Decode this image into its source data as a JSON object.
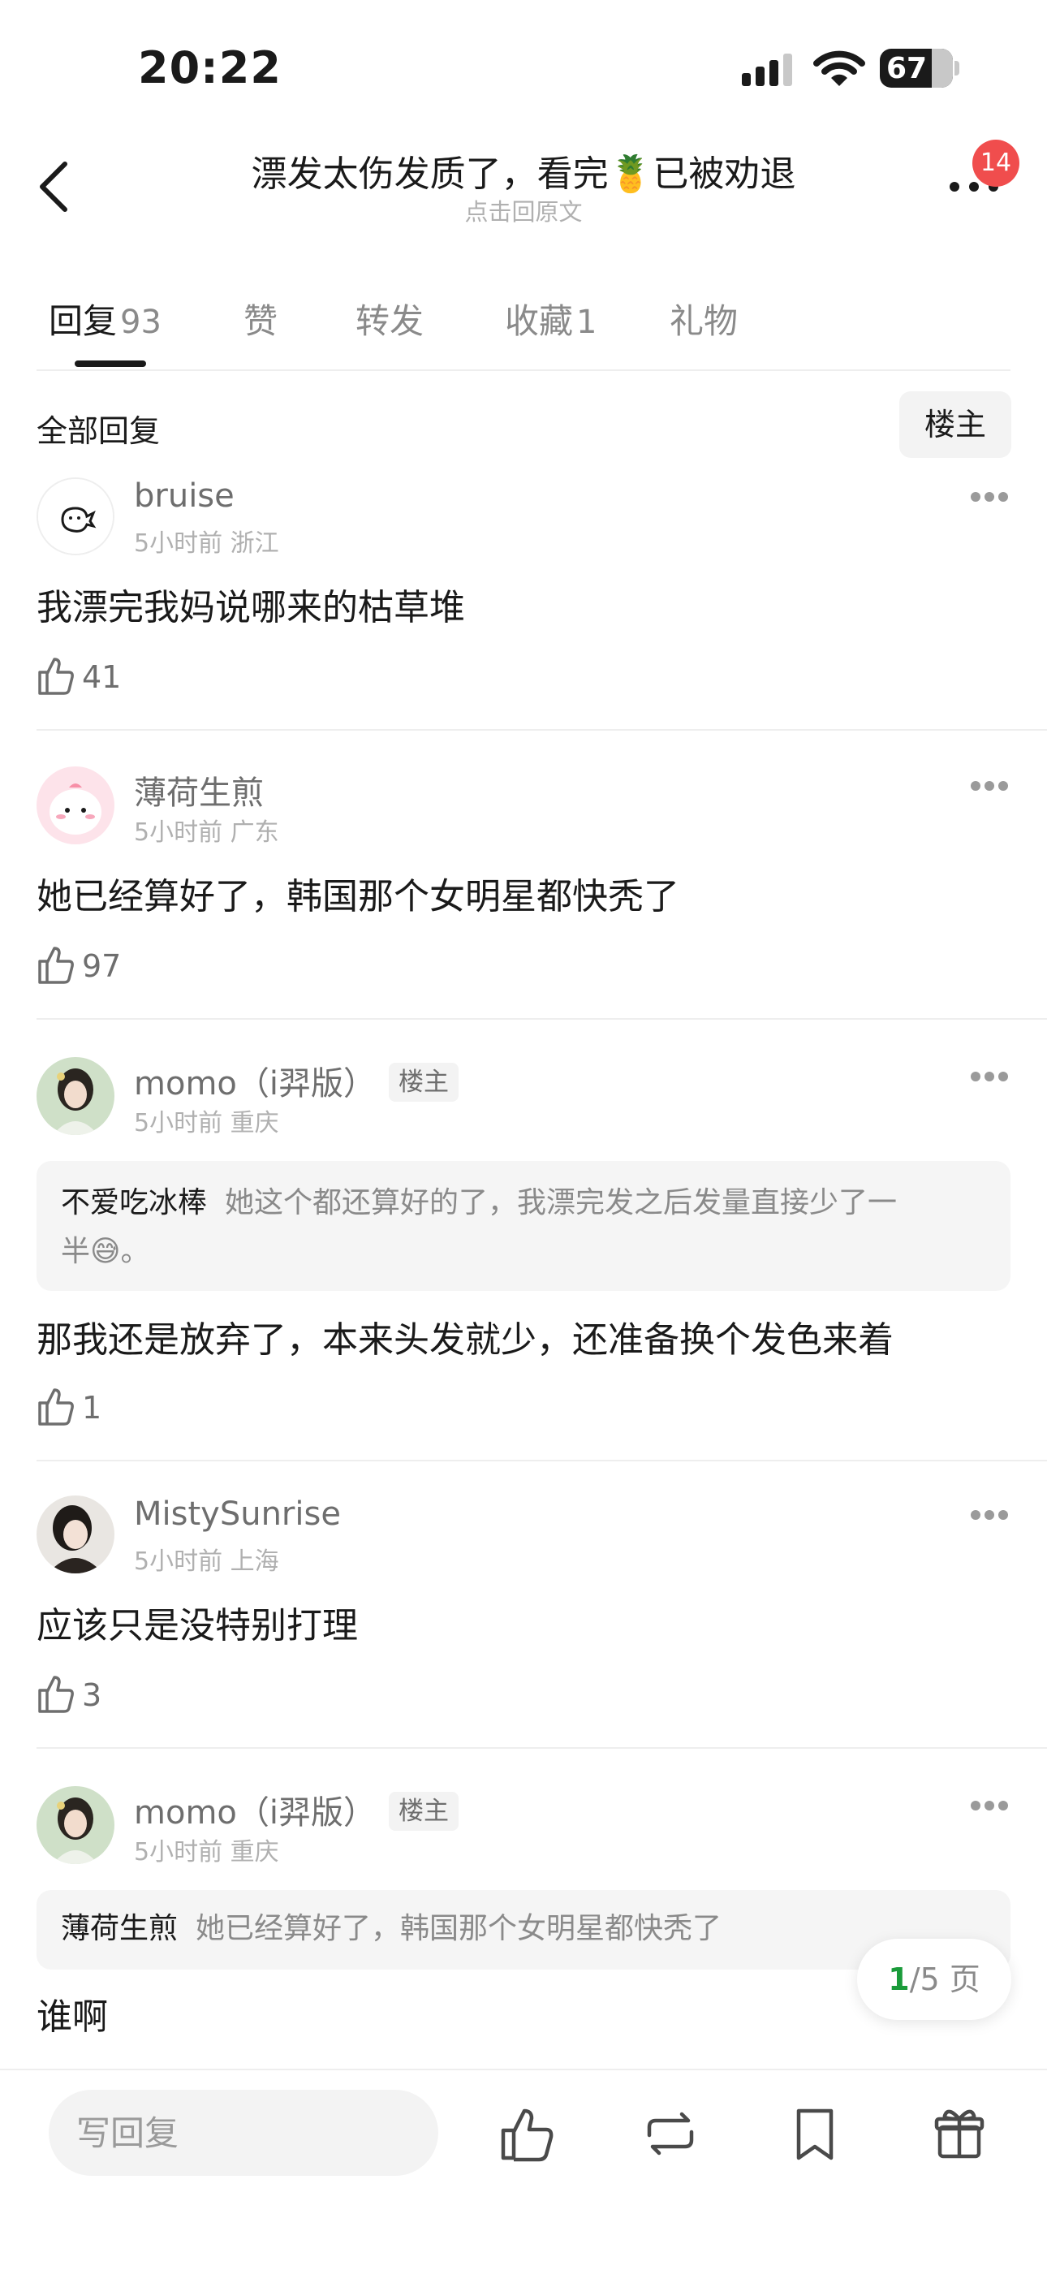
{
  "status_bar": {
    "time": "20:22",
    "battery": "67"
  },
  "header": {
    "title": "漂发太伤发质了，看完🍍已被劝退",
    "subtitle": "点击回原文",
    "notification_count": "14"
  },
  "tabs": [
    {
      "label": "回复",
      "count": "93"
    },
    {
      "label": "赞",
      "count": ""
    },
    {
      "label": "转发",
      "count": ""
    },
    {
      "label": "收藏",
      "count": "1"
    },
    {
      "label": "礼物",
      "count": ""
    }
  ],
  "section": {
    "title": "全部回复",
    "op_filter_label": "楼主"
  },
  "comments": [
    {
      "name": "bruise",
      "meta": "5小时前 浙江",
      "text": "我漂完我妈说哪来的枯草堆",
      "likes": "41"
    },
    {
      "name": "薄荷生煎",
      "meta": "5小时前 广东",
      "text": "她已经算好了，韩国那个女明星都快秃了",
      "likes": "97"
    },
    {
      "name": "momo（i羿版）",
      "op_tag": "楼主",
      "meta": "5小时前 重庆",
      "quote_name": "不爱吃冰棒",
      "quote_line1": "她这个都还算好的了，我漂完发之后发量直接少了一",
      "quote_line2": "半😅。",
      "text": "那我还是放弃了，本来头发就少，还准备换个发色来着",
      "likes": "1"
    },
    {
      "name": "MistySunrise",
      "meta": "5小时前 上海",
      "text": "应该只是没特别打理",
      "likes": "3"
    },
    {
      "name": "momo（i羿版）",
      "op_tag": "楼主",
      "meta": "5小时前 重庆",
      "quote_name": "薄荷生煎",
      "quote_line1": "她已经算好了，韩国那个女明星都快秃了",
      "text": "谁啊"
    }
  ],
  "pager": {
    "current": "1",
    "total_text": "/5 页"
  },
  "bottom_bar": {
    "reply_placeholder": "写回复"
  },
  "icons": [
    "back-arrow-icon",
    "more-dots-icon",
    "thumbs-up-icon",
    "repost-icon",
    "bookmark-icon",
    "gift-icon",
    "wifi-icon",
    "signal-icon",
    "battery-icon"
  ],
  "colors": {
    "accent_green": "#1a9b3a",
    "badge_red": "#f04d4d",
    "muted_text": "#8a8a8a"
  }
}
